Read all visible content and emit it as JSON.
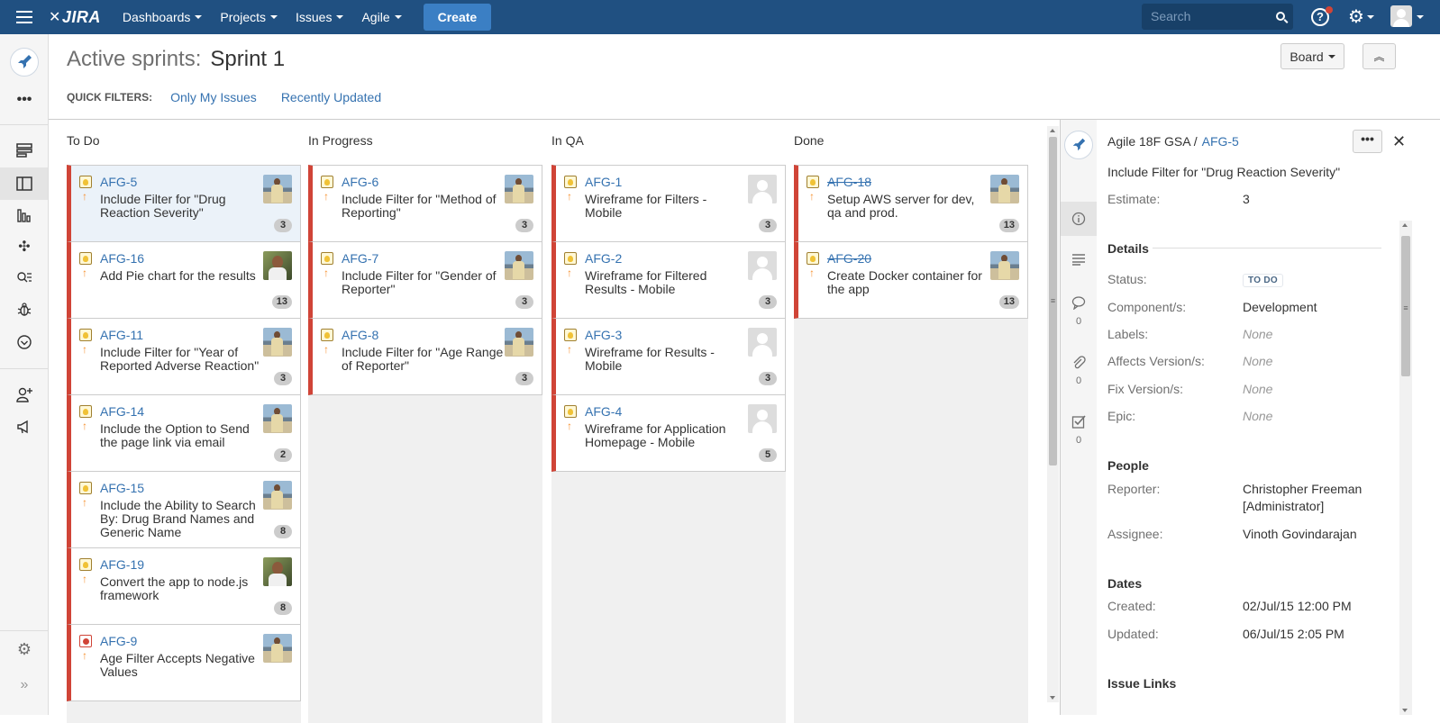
{
  "header": {
    "logo": "JIRA",
    "nav": [
      "Dashboards",
      "Projects",
      "Issues",
      "Agile"
    ],
    "create_label": "Create",
    "search_placeholder": "Search"
  },
  "page": {
    "title_prefix": "Active sprints:",
    "sprint_name": "Sprint 1",
    "quick_filters_label": "QUICK FILTERS:",
    "quick_filters": [
      "Only My Issues",
      "Recently Updated"
    ],
    "board_label": "Board"
  },
  "columns": [
    {
      "title": "To Do",
      "cards": [
        {
          "key": "AFG-5",
          "summary": "Include Filter for \"Drug Reaction Severity\"",
          "estimate": "3",
          "avatar": "pA",
          "type": "improvement",
          "selected": true
        },
        {
          "key": "AFG-16",
          "summary": "Add Pie chart for the results",
          "estimate": "13",
          "avatar": "pB",
          "type": "improvement"
        },
        {
          "key": "AFG-11",
          "summary": "Include Filter for \"Year of Reported Adverse Reaction\"",
          "estimate": "3",
          "avatar": "pA",
          "type": "improvement"
        },
        {
          "key": "AFG-14",
          "summary": "Include the Option to Send the page link via email",
          "estimate": "2",
          "avatar": "pA",
          "type": "improvement"
        },
        {
          "key": "AFG-15",
          "summary": "Include the Ability to Search By: Drug Brand Names and Generic Name",
          "estimate": "8",
          "avatar": "pA",
          "type": "improvement"
        },
        {
          "key": "AFG-19",
          "summary": "Convert the app to node.js framework",
          "estimate": "8",
          "avatar": "pB",
          "type": "improvement"
        },
        {
          "key": "AFG-9",
          "summary": "Age Filter Accepts Negative Values",
          "estimate": "",
          "avatar": "pA",
          "type": "bug"
        }
      ]
    },
    {
      "title": "In Progress",
      "cards": [
        {
          "key": "AFG-6",
          "summary": "Include Filter for \"Method of Reporting\"",
          "estimate": "3",
          "avatar": "pA",
          "type": "improvement"
        },
        {
          "key": "AFG-7",
          "summary": "Include Filter for \"Gender of Reporter\"",
          "estimate": "3",
          "avatar": "pA",
          "type": "improvement"
        },
        {
          "key": "AFG-8",
          "summary": "Include Filter for \"Age Range of Reporter\"",
          "estimate": "3",
          "avatar": "pA",
          "type": "improvement"
        }
      ]
    },
    {
      "title": "In QA",
      "cards": [
        {
          "key": "AFG-1",
          "summary": "Wireframe for Filters - Mobile",
          "estimate": "3",
          "avatar": "pD",
          "type": "improvement"
        },
        {
          "key": "AFG-2",
          "summary": "Wireframe for Filtered Results - Mobile",
          "estimate": "3",
          "avatar": "pD",
          "type": "improvement"
        },
        {
          "key": "AFG-3",
          "summary": "Wireframe for Results - Mobile",
          "estimate": "3",
          "avatar": "pD",
          "type": "improvement"
        },
        {
          "key": "AFG-4",
          "summary": "Wireframe for Application Homepage - Mobile",
          "estimate": "5",
          "avatar": "pD",
          "type": "improvement"
        }
      ]
    },
    {
      "title": "Done",
      "cards": [
        {
          "key": "AFG-18",
          "summary": "Setup AWS server for dev, qa and prod.",
          "estimate": "13",
          "avatar": "pA",
          "type": "improvement",
          "done": true
        },
        {
          "key": "AFG-20",
          "summary": "Create Docker container for the app",
          "estimate": "13",
          "avatar": "pA",
          "type": "improvement",
          "done": true
        }
      ]
    }
  ],
  "detail": {
    "project": "Agile 18F GSA /",
    "issue_key": "AFG-5",
    "title": "Include Filter for \"Drug Reaction Severity\"",
    "estimate_label": "Estimate:",
    "estimate_value": "3",
    "details_heading": "Details",
    "status_label": "Status:",
    "status_value": "TO DO",
    "component_label": "Component/s:",
    "component_value": "Development",
    "labels_label": "Labels:",
    "labels_value": "None",
    "affects_label": "Affects Version/s:",
    "affects_value": "None",
    "fix_label": "Fix Version/s:",
    "fix_value": "None",
    "epic_label": "Epic:",
    "epic_value": "None",
    "people_heading": "People",
    "reporter_label": "Reporter:",
    "reporter_value_1": "Christopher Freeman",
    "reporter_value_2": "[Administrator]",
    "assignee_label": "Assignee:",
    "assignee_value": "Vinoth Govindarajan",
    "dates_heading": "Dates",
    "created_label": "Created:",
    "created_value": "02/Jul/15 12:00 PM",
    "updated_label": "Updated:",
    "updated_value": "06/Jul/15 2:05 PM",
    "links_heading": "Issue Links",
    "comments_count": "0",
    "attachments_count": "0",
    "subtasks_count": "0"
  }
}
